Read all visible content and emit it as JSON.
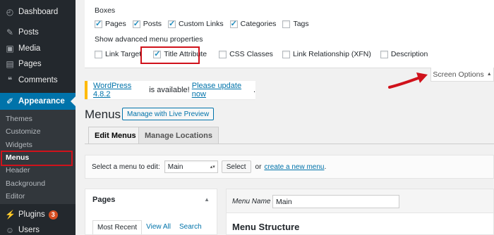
{
  "sidebar": {
    "items": [
      {
        "label": "Dashboard",
        "icon": "dashboard-icon",
        "glyph": "◴"
      },
      {
        "label": "Posts",
        "icon": "pin-icon",
        "glyph": "✎"
      },
      {
        "label": "Media",
        "icon": "media-icon",
        "glyph": "▣"
      },
      {
        "label": "Pages",
        "icon": "pages-icon",
        "glyph": "▤"
      },
      {
        "label": "Comments",
        "icon": "comments-icon",
        "glyph": "❝"
      },
      {
        "label": "Appearance",
        "icon": "brush-icon",
        "glyph": "✐"
      }
    ],
    "submenu": [
      "Themes",
      "Customize",
      "Widgets",
      "Menus",
      "Header",
      "Background",
      "Editor"
    ],
    "plugins": {
      "label": "Plugins",
      "badge": "3",
      "glyph": "⚡"
    },
    "users": {
      "label": "Users",
      "glyph": "☺"
    }
  },
  "screen_options": {
    "boxes_label": "Boxes",
    "boxes": [
      {
        "label": "Pages",
        "checked": true
      },
      {
        "label": "Posts",
        "checked": true
      },
      {
        "label": "Custom Links",
        "checked": true
      },
      {
        "label": "Categories",
        "checked": true
      },
      {
        "label": "Tags",
        "checked": false
      }
    ],
    "advanced_label": "Show advanced menu properties",
    "advanced": [
      {
        "label": "Link Target",
        "checked": false
      },
      {
        "label": "Title Attribute",
        "checked": true
      },
      {
        "label": "CSS Classes",
        "checked": false
      },
      {
        "label": "Link Relationship (XFN)",
        "checked": false
      },
      {
        "label": "Description",
        "checked": false
      }
    ],
    "tab_label": "Screen Options",
    "tab_glyph": "▲"
  },
  "notice": {
    "link": "WordPress 4.8.2",
    "text": " is available! ",
    "update_link": "Please update now",
    "end": "."
  },
  "page": {
    "title": "Menus",
    "preview_button": "Manage with Live Preview",
    "tabs": [
      "Edit Menus",
      "Manage Locations"
    ]
  },
  "select_bar": {
    "label": "Select a menu to edit:",
    "selected": "Main",
    "button": "Select",
    "or": "or",
    "create_link": "create a new menu",
    "end": "."
  },
  "pages_box": {
    "title": "Pages",
    "toggle_glyph": "▲",
    "tabs": [
      "Most Recent",
      "View All",
      "Search"
    ]
  },
  "menu_box": {
    "name_label": "Menu Name",
    "name_value": "Main",
    "structure_title": "Menu Structure"
  },
  "colors": {
    "accent": "#0073aa",
    "highlight": "#d0121b",
    "notice": "#ffba00"
  }
}
